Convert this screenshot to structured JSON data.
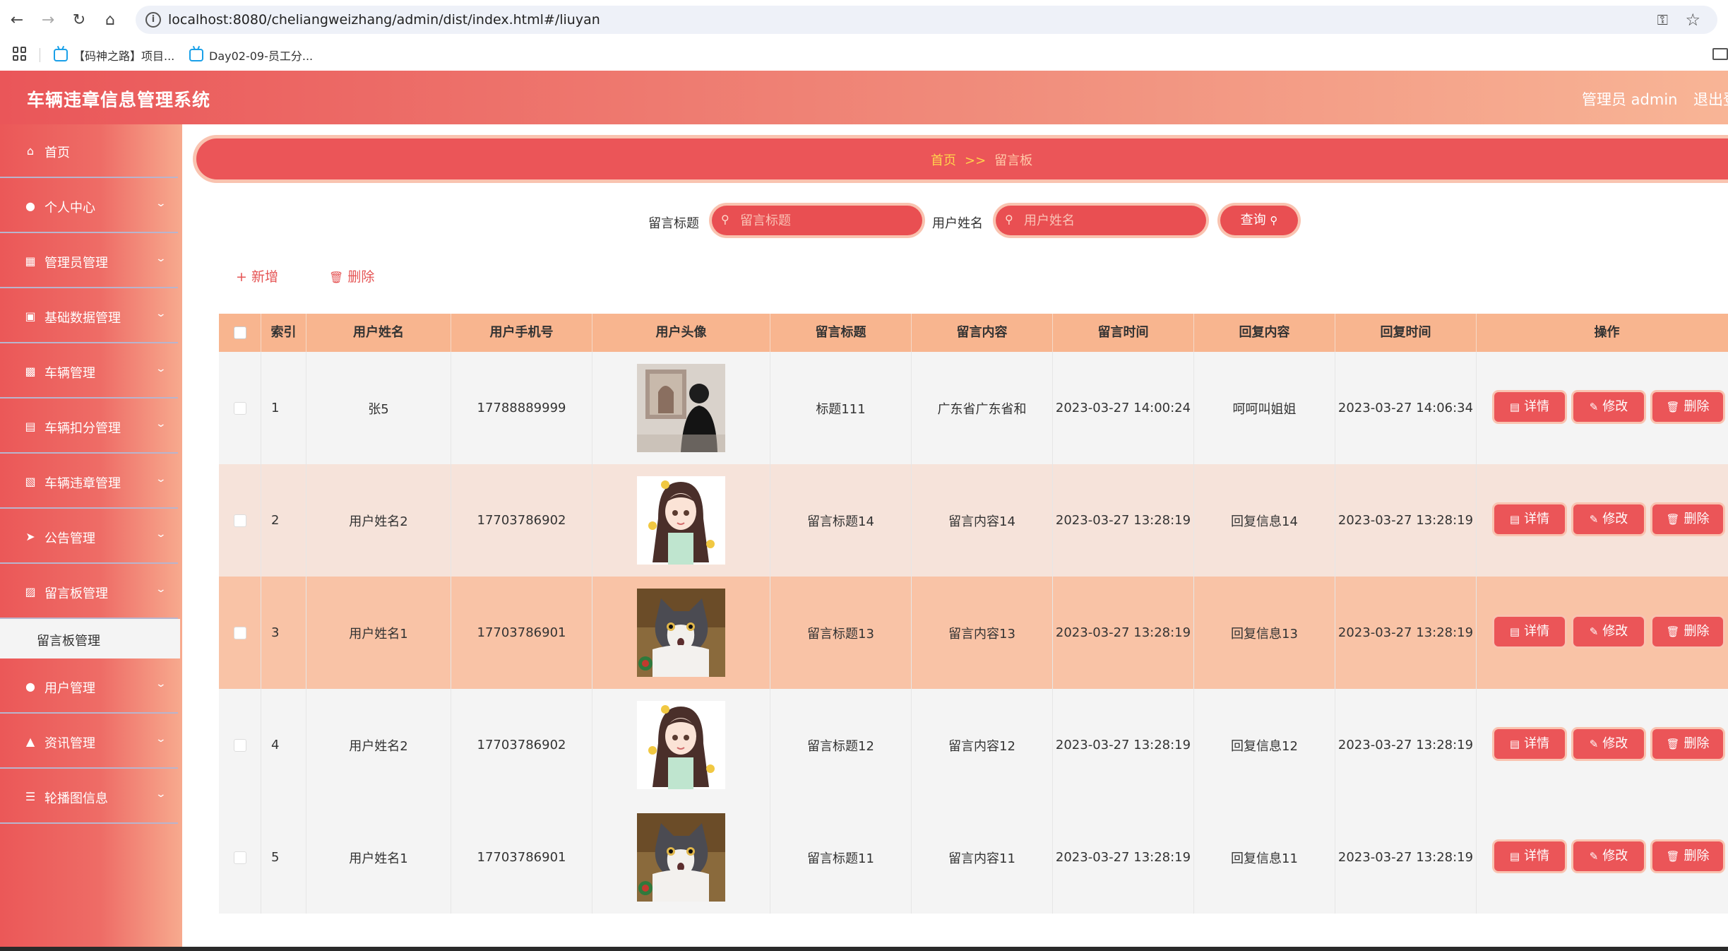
{
  "browser": {
    "url": "localhost:8080/cheliangweizhang/admin/dist/index.html#/liuyan",
    "bookmarks": [
      "【码神之路】项目...",
      "Day02-09-员工分..."
    ]
  },
  "header": {
    "title": "车辆违章信息管理系统",
    "user": "管理员 admin",
    "logout": "退出登"
  },
  "sidebar": {
    "items": [
      {
        "label": "首页",
        "icon": "home-icon"
      },
      {
        "label": "个人中心",
        "icon": "user-icon"
      },
      {
        "label": "管理员管理",
        "icon": "grid-icon"
      },
      {
        "label": "基础数据管理",
        "icon": "briefcase-icon"
      },
      {
        "label": "车辆管理",
        "icon": "monitor-icon"
      },
      {
        "label": "车辆扣分管理",
        "icon": "chat-icon"
      },
      {
        "label": "车辆违章管理",
        "icon": "clipboard-icon"
      },
      {
        "label": "公告管理",
        "icon": "send-icon"
      },
      {
        "label": "留言板管理",
        "icon": "picture-icon"
      },
      {
        "label": "用户管理",
        "icon": "user-icon"
      },
      {
        "label": "资讯管理",
        "icon": "trophy-icon"
      },
      {
        "label": "轮播图信息",
        "icon": "list-icon"
      }
    ],
    "active_sub": "留言板管理"
  },
  "breadcrumb": {
    "home": "首页",
    "sep": ">>",
    "current": "留言板"
  },
  "search": {
    "title_label": "留言标题",
    "title_placeholder": "留言标题",
    "name_label": "用户姓名",
    "name_placeholder": "用户姓名",
    "query_button": "查询"
  },
  "actions": {
    "add": "新增",
    "delete": "删除"
  },
  "table": {
    "headers": [
      "索引",
      "用户姓名",
      "用户手机号",
      "用户头像",
      "留言标题",
      "留言内容",
      "留言时间",
      "回复内容",
      "回复时间",
      "操作"
    ],
    "buttons": {
      "detail": "详情",
      "edit": "修改",
      "delete": "删除"
    },
    "rows": [
      {
        "index": "1",
        "name": "张5",
        "phone": "17788889999",
        "avatar": "photo",
        "title": "标题111",
        "content": "广东省广东省和",
        "time": "2023-03-27 14:00:24",
        "reply": "呵呵叫姐姐",
        "reply_time": "2023-03-27 14:06:34"
      },
      {
        "index": "2",
        "name": "用户姓名2",
        "phone": "17703786902",
        "avatar": "girl",
        "title": "留言标题14",
        "content": "留言内容14",
        "time": "2023-03-27 13:28:19",
        "reply": "回复信息14",
        "reply_time": "2023-03-27 13:28:19"
      },
      {
        "index": "3",
        "name": "用户姓名1",
        "phone": "17703786901",
        "avatar": "cat",
        "title": "留言标题13",
        "content": "留言内容13",
        "time": "2023-03-27 13:28:19",
        "reply": "回复信息13",
        "reply_time": "2023-03-27 13:28:19"
      },
      {
        "index": "4",
        "name": "用户姓名2",
        "phone": "17703786902",
        "avatar": "girl",
        "title": "留言标题12",
        "content": "留言内容12",
        "time": "2023-03-27 13:28:19",
        "reply": "回复信息12",
        "reply_time": "2023-03-27 13:28:19"
      },
      {
        "index": "5",
        "name": "用户姓名1",
        "phone": "17703786901",
        "avatar": "cat",
        "title": "留言标题11",
        "content": "留言内容11",
        "time": "2023-03-27 13:28:19",
        "reply": "回复信息11",
        "reply_time": "2023-03-27 13:28:19"
      }
    ]
  },
  "colors": {
    "primary": "#eb5558",
    "header_gradient_end": "#f8b596",
    "table_header": "#f8b58f",
    "row_alt_light": "#f6e3da",
    "row_alt_strong": "#f9c3a6",
    "breadcrumb_home": "#ffd34d"
  }
}
